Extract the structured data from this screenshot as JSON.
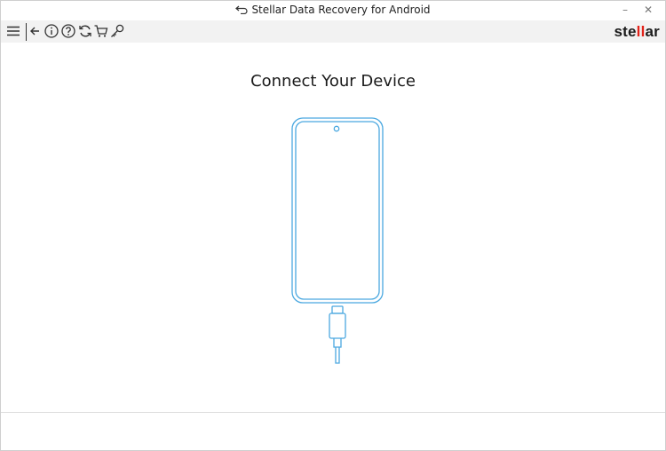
{
  "window": {
    "title": "Stellar Data Recovery for Android",
    "minimize_label": "–",
    "close_label": "✕"
  },
  "toolbar": {
    "icons": [
      "menu-icon",
      "back-arrow-icon",
      "info-icon",
      "help-icon",
      "refresh-icon",
      "cart-icon",
      "key-icon"
    ],
    "logo": {
      "prefix": "ste",
      "highlight": "ll",
      "suffix": "ar",
      "accent_color": "#e2231a"
    }
  },
  "main": {
    "heading": "Connect Your Device",
    "illustration": "phone-with-usb-cable",
    "accent_color": "#4aa8e0"
  }
}
